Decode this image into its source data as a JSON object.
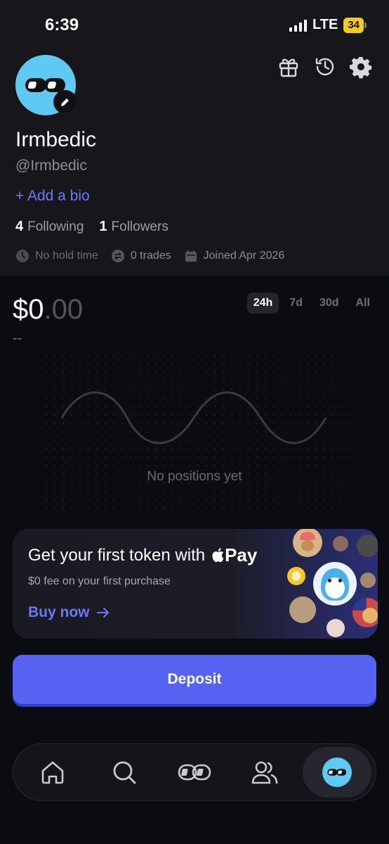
{
  "status": {
    "time": "6:39",
    "network": "LTE",
    "battery": "34"
  },
  "header": {
    "icons": [
      "gift-icon",
      "history-icon",
      "gear-icon"
    ]
  },
  "profile": {
    "username": "Irmbedic",
    "handle": "@Irmbedic",
    "add_bio": "+ Add a bio",
    "following_count": "4",
    "following_label": "Following",
    "followers_count": "1",
    "followers_label": "Followers",
    "hold_time": "No hold time",
    "trades": "0 trades",
    "joined": "Joined Apr 2026"
  },
  "portfolio": {
    "balance_main": "$0",
    "balance_cents": ".00",
    "change": "--",
    "ranges": [
      "24h",
      "7d",
      "30d",
      "All"
    ],
    "active_range": "24h",
    "empty_text": "No positions yet"
  },
  "promo": {
    "title": "Get your first token with",
    "pay_label": "Pay",
    "subtitle": "$0 fee on your first purchase",
    "cta": "Buy now"
  },
  "deposit": {
    "label": "Deposit"
  },
  "nav": {
    "items": [
      "home-icon",
      "search-icon",
      "pump-icon",
      "people-icon",
      "profile-avatar-icon"
    ],
    "active": "profile-avatar-icon"
  },
  "colors": {
    "accent": "#5562f2",
    "link": "#6b79f7",
    "avatar_bg": "#5ec9f2",
    "battery": "#f5cc1d"
  }
}
